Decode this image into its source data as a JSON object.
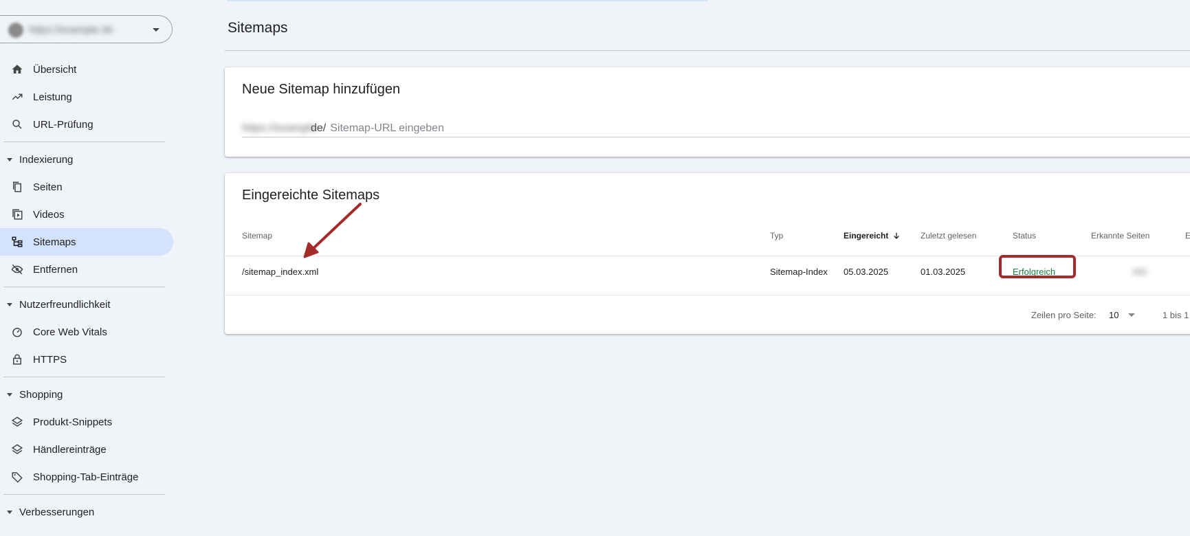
{
  "sidebar": {
    "property_name": "https://example.de",
    "items_top": [
      {
        "label": "Übersicht",
        "icon": "home-icon"
      },
      {
        "label": "Leistung",
        "icon": "trending-up-icon"
      },
      {
        "label": "URL-Prüfung",
        "icon": "search-icon"
      }
    ],
    "sections": [
      {
        "label": "Indexierung",
        "items": [
          {
            "label": "Seiten",
            "icon": "pages-icon"
          },
          {
            "label": "Videos",
            "icon": "video-icon"
          },
          {
            "label": "Sitemaps",
            "icon": "sitemap-icon",
            "active": true
          },
          {
            "label": "Entfernen",
            "icon": "hidden-eye-icon"
          }
        ]
      },
      {
        "label": "Nutzerfreundlichkeit",
        "items": [
          {
            "label": "Core Web Vitals",
            "icon": "gauge-icon"
          },
          {
            "label": "HTTPS",
            "icon": "lock-icon"
          }
        ]
      },
      {
        "label": "Shopping",
        "items": [
          {
            "label": "Produkt-Snippets",
            "icon": "layers-icon"
          },
          {
            "label": "Händlereinträge",
            "icon": "layers-icon"
          },
          {
            "label": "Shopping-Tab-Einträge",
            "icon": "tag-icon"
          }
        ]
      },
      {
        "label": "Verbesserungen",
        "items": []
      }
    ]
  },
  "main": {
    "title": "Sitemaps",
    "add_card": {
      "title": "Neue Sitemap hinzufügen",
      "domain_prefix": "https://example.",
      "domain_suffix": "de/",
      "placeholder": "Sitemap-URL eingeben"
    },
    "submitted_card": {
      "title": "Eingereichte Sitemaps",
      "columns": {
        "sitemap": "Sitemap",
        "typ": "Typ",
        "eingereicht": "Eingereicht",
        "zuletzt": "Zuletzt gelesen",
        "status": "Status",
        "erkannte_seiten": "Erkannte Seiten",
        "extra": "E"
      },
      "rows": [
        {
          "sitemap": "/sitemap_index.xml",
          "typ": "Sitemap-Index",
          "eingereicht": "05.03.2025",
          "zuletzt": "01.03.2025",
          "status": "Erfolgreich",
          "erkannte_seiten": "300"
        }
      ],
      "footer": {
        "rows_per_page_label": "Zeilen pro Seite:",
        "rows_per_page_value": "10",
        "range": "1 bis 1"
      }
    }
  },
  "colors": {
    "accent_active": "#d3e3fd",
    "status_success": "#188038",
    "annotation": "#a52a2a"
  }
}
